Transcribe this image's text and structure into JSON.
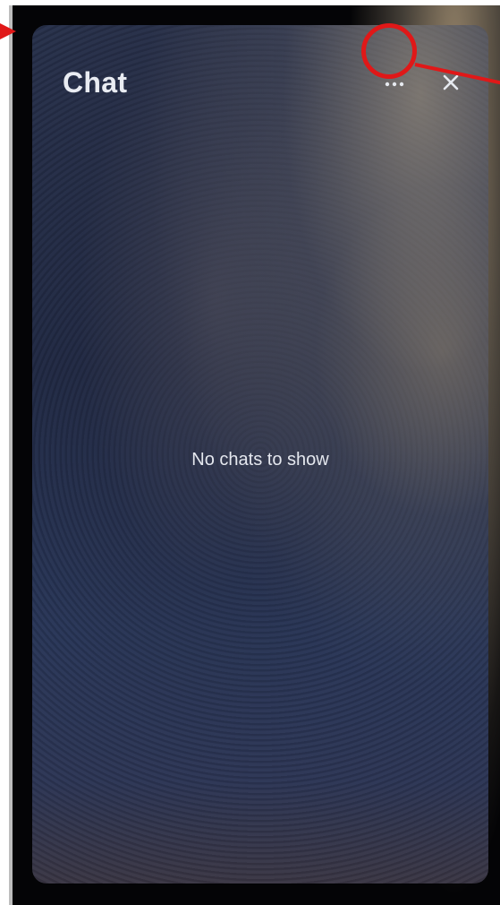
{
  "panel": {
    "title": "Chat",
    "more_icon": "more-horizontal-icon",
    "close_icon": "close-icon"
  },
  "empty_state": {
    "message": "No chats to show"
  },
  "annotation": {
    "color": "#e01818",
    "target": "more-button"
  }
}
